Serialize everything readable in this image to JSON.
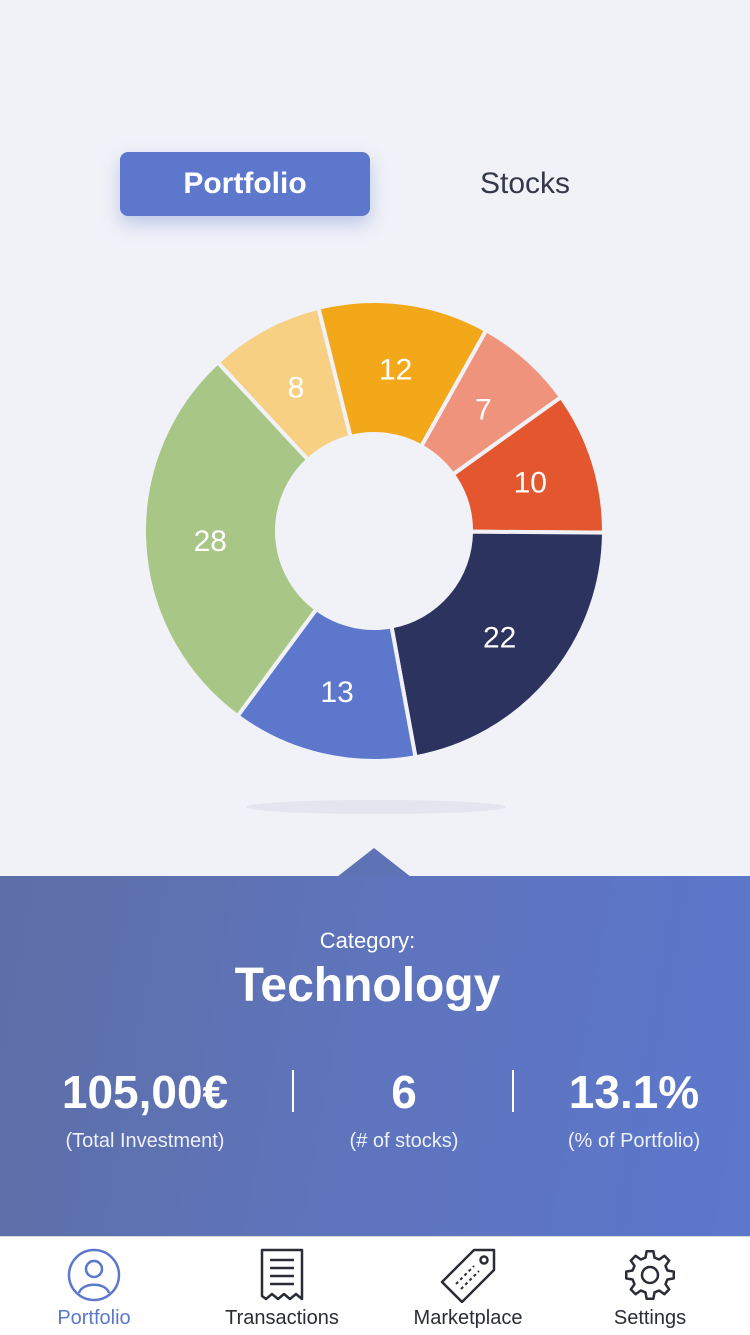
{
  "tabs": {
    "portfolio": "Portfolio",
    "stocks": "Stocks"
  },
  "chart_data": {
    "type": "pie",
    "subtype": "donut",
    "slices": [
      {
        "value": 12,
        "color": "#f2a819"
      },
      {
        "value": 7,
        "color": "#ef937c"
      },
      {
        "value": 10,
        "color": "#e4572e"
      },
      {
        "value": 22,
        "color": "#2b335e"
      },
      {
        "value": 13,
        "color": "#5c77cc"
      },
      {
        "value": 28,
        "color": "#a8c686"
      },
      {
        "value": 8,
        "color": "#f8d083"
      }
    ],
    "selected_slice": 4
  },
  "detail": {
    "category_label": "Category:",
    "category_name": "Technology",
    "stats": [
      {
        "value": "105,00€",
        "caption": "(Total Investment)"
      },
      {
        "value": "6",
        "caption": "(# of stocks)"
      },
      {
        "value": "13.1%",
        "caption": "(% of Portfolio)"
      }
    ]
  },
  "tabbar": {
    "items": [
      {
        "label": "Portfolio",
        "icon": "user-icon",
        "active": true
      },
      {
        "label": "Transactions",
        "icon": "receipt-icon",
        "active": false
      },
      {
        "label": "Marketplace",
        "icon": "tag-icon",
        "active": false
      },
      {
        "label": "Settings",
        "icon": "gear-icon",
        "active": false
      }
    ]
  },
  "colors": {
    "accent": "#5c77cc",
    "background": "#f1f2f8"
  }
}
